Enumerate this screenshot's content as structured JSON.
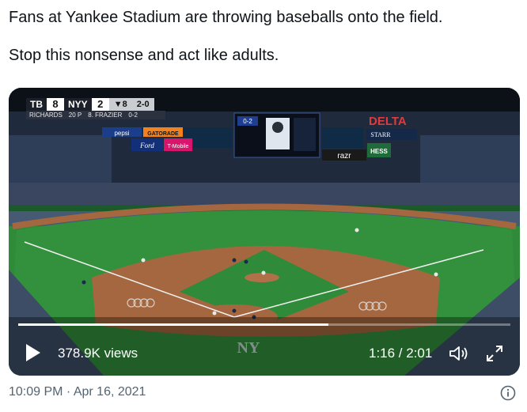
{
  "tweet": {
    "line1": "Fans at Yankee Stadium are throwing baseballs onto the field.",
    "line2": "Stop this nonsense and act like adults."
  },
  "scorebug": {
    "away_team": "TB",
    "away_score": "8",
    "home_team": "NYY",
    "home_score": "2",
    "count": "2-0",
    "inning": "▼8",
    "pitcher": "RICHARDS",
    "pitch_count": "20 P",
    "batter": "8. FRAZIER",
    "batter_line": "0-2"
  },
  "stadium": {
    "scoreboard_count": "0-2",
    "sponsors": [
      "DELTA",
      "pepsi",
      "GATORADE",
      "Ford",
      "T-Mobile",
      "razr",
      "HESS",
      "STARR"
    ]
  },
  "video": {
    "views": "378.9K views",
    "time": "1:16 / 2:01",
    "progress": 0.63,
    "icons": [
      "play-icon",
      "volume-icon",
      "fullscreen-icon"
    ]
  },
  "meta": {
    "timestamp": "10:09 PM · Apr 16, 2021",
    "icon": "info-icon"
  },
  "colors": {
    "text": "#0f1419",
    "secondary": "#536471",
    "grass": "#2f8a3a",
    "dirt": "#a5673f",
    "delta_red": "#e03a3e"
  }
}
